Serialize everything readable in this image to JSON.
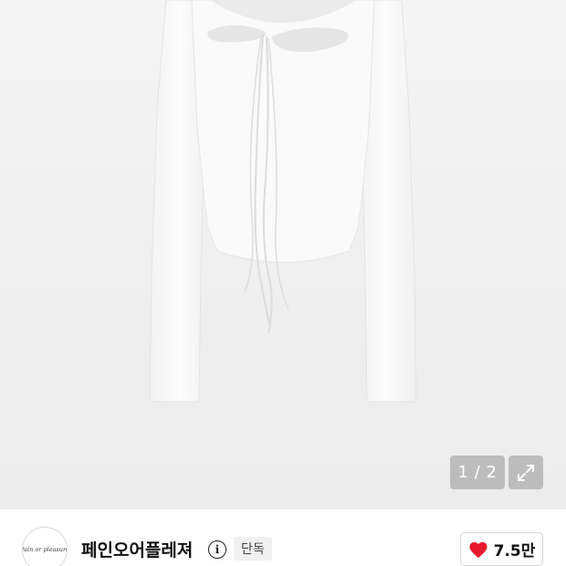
{
  "gallery": {
    "image_label": "white long-sleeve top with cut-out neckline and tie strings",
    "pager": "1 / 2",
    "expand_icon": "expand-icon"
  },
  "seller": {
    "logo_text": "Pain or pleasure",
    "name": "페인오어플레져",
    "info_icon": "info-icon",
    "badge": "단독"
  },
  "like": {
    "icon": "heart-icon",
    "count": "7.5만",
    "color": "#e8182f"
  }
}
